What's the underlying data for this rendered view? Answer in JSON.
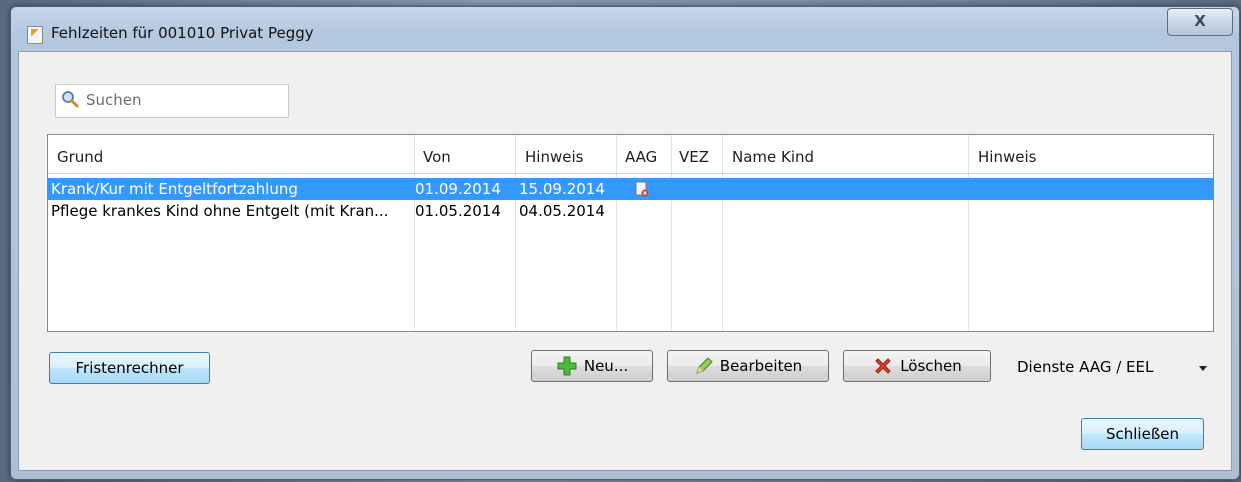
{
  "window": {
    "title": "Fehlzeiten für 001010 Privat Peggy",
    "close_label": "X"
  },
  "search": {
    "placeholder": "Suchen"
  },
  "table": {
    "columns": [
      "Grund",
      "Von",
      "Hinweis",
      "AAG",
      "VEZ",
      "Name Kind",
      "Hinweis"
    ],
    "rows": [
      {
        "grund": "Krank/Kur mit Entgeltfortzahlung",
        "von": "01.09.2014",
        "hinweis": "15.09.2014",
        "aag_icon": "document-delete-icon",
        "vez": "",
        "name_kind": "",
        "hinweis2": "",
        "selected": true
      },
      {
        "grund": "Pflege krankes Kind ohne Entgelt (mit Kran...",
        "von": "01.05.2014",
        "hinweis": "04.05.2014",
        "aag_icon": "",
        "vez": "",
        "name_kind": "",
        "hinweis2": "",
        "selected": false
      }
    ]
  },
  "buttons": {
    "fristenrechner": "Fristenrechner",
    "neu": "Neu...",
    "bearbeiten": "Bearbeiten",
    "loeschen": "Löschen",
    "schliessen": "Schließen"
  },
  "dienste": {
    "label": "Dienste AAG / EEL"
  },
  "colors": {
    "selection": "#3399ff",
    "titlebar": "#b9cbe1"
  }
}
